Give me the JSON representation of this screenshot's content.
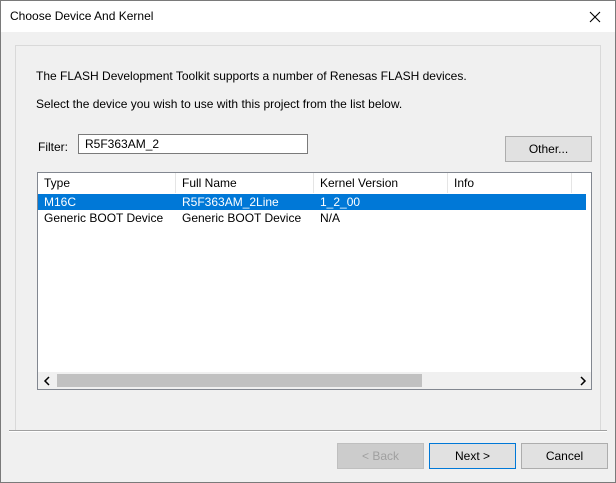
{
  "window": {
    "title": "Choose Device And Kernel"
  },
  "description": {
    "line1": "The FLASH Development Toolkit supports a number of Renesas FLASH devices.",
    "line2": "Select the device you wish to use with this project from the list below."
  },
  "filter": {
    "label": "Filter:",
    "value": "R5F363AM_2"
  },
  "buttons": {
    "other": "Other...",
    "back": "< Back",
    "next": "Next >",
    "cancel": "Cancel"
  },
  "table": {
    "columns": [
      "Type",
      "Full Name",
      "Kernel Version",
      "Info"
    ],
    "rows": [
      {
        "type": "M16C",
        "full_name": "R5F363AM_2Line",
        "kernel_version": "1_2_00",
        "info": "",
        "selected": true
      },
      {
        "type": "Generic BOOT Device",
        "full_name": "Generic BOOT Device",
        "kernel_version": "N/A",
        "info": "",
        "selected": false
      }
    ]
  },
  "colors": {
    "selection": "#0078d7",
    "dialog_bg": "#f0f0f0"
  }
}
